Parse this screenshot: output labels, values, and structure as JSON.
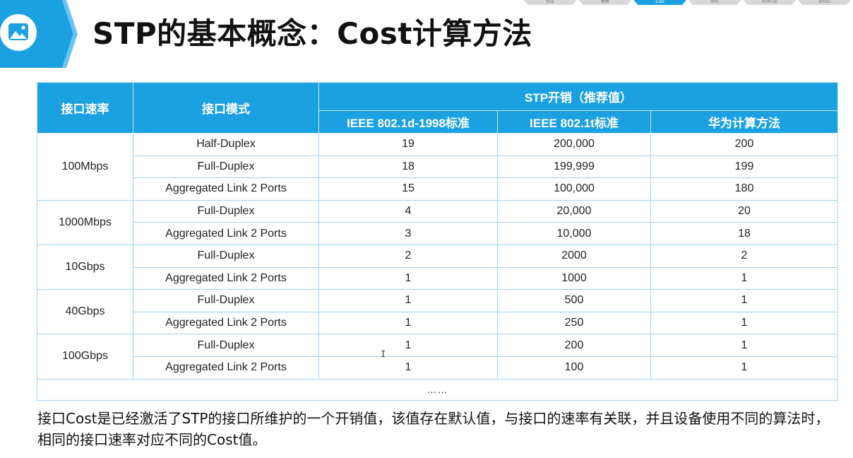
{
  "slide": {
    "title": "STP的基本概念：Cost计算方法",
    "tabs": [
      "协议",
      "根桥",
      "Cost",
      "RPC",
      "PORTID",
      "BPDU"
    ],
    "active_tab_index": 2,
    "accent_color": "#1ba1e2"
  },
  "table": {
    "headers": {
      "col_speed": "接口速率",
      "col_mode": "接口模式",
      "group_cost": "STP开销（推荐值）",
      "ieee_1998": "IEEE 802.1d-1998标准",
      "ieee_t": "IEEE 802.1t标准",
      "huawei": "华为计算方法"
    },
    "rows": [
      {
        "speed": "100Mbps",
        "span": 3,
        "mode": "Half-Duplex",
        "v1998": "19",
        "vt": "200,000",
        "huawei": "200"
      },
      {
        "mode": "Full-Duplex",
        "v1998": "18",
        "vt": "199,999",
        "huawei": "199"
      },
      {
        "mode": "Aggregated Link 2 Ports",
        "v1998": "15",
        "vt": "100,000",
        "huawei": "180"
      },
      {
        "speed": "1000Mbps",
        "span": 2,
        "mode": "Full-Duplex",
        "v1998": "4",
        "vt": "20,000",
        "huawei": "20"
      },
      {
        "mode": "Aggregated Link 2 Ports",
        "v1998": "3",
        "vt": "10,000",
        "huawei": "18"
      },
      {
        "speed": "10Gbps",
        "span": 2,
        "mode": "Full-Duplex",
        "v1998": "2",
        "vt": "2000",
        "huawei": "2"
      },
      {
        "mode": "Aggregated Link 2 Ports",
        "v1998": "1",
        "vt": "1000",
        "huawei": "1"
      },
      {
        "speed": "40Gbps",
        "span": 2,
        "mode": "Full-Duplex",
        "v1998": "1",
        "vt": "500",
        "huawei": "1"
      },
      {
        "mode": "Aggregated Link 2 Ports",
        "v1998": "1",
        "vt": "250",
        "huawei": "1"
      },
      {
        "speed": "100Gbps",
        "span": 2,
        "mode": "Full-Duplex",
        "v1998": "1",
        "vt": "200",
        "huawei": "1"
      },
      {
        "mode": "Aggregated Link 2 Ports",
        "v1998": "1",
        "vt": "100",
        "huawei": "1"
      }
    ],
    "ellipsis": "……"
  },
  "note": "接口Cost是已经激活了STP的接口所维护的一个开销值，该值存在默认值，与接口的速率有关联，并且设备使用不同的算法时，相同的接口速率对应不同的Cost值。"
}
